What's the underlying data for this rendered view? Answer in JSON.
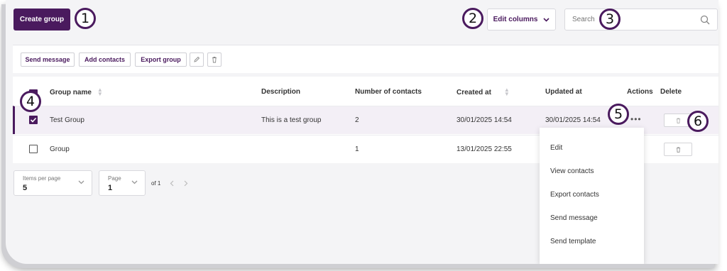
{
  "header": {
    "create_group_label": "Create group",
    "edit_columns_label": "Edit columns",
    "search_placeholder": "Search"
  },
  "toolbar": {
    "send_message_label": "Send message",
    "add_contacts_label": "Add contacts",
    "export_group_label": "Export group"
  },
  "table": {
    "columns": {
      "group_name": "Group name",
      "description": "Description",
      "number_of_contacts": "Number of contacts",
      "created_at": "Created at",
      "updated_at": "Updated at",
      "actions": "Actions",
      "delete": "Delete"
    },
    "rows": [
      {
        "name": "Test Group",
        "description": "This is a test group",
        "contacts": "2",
        "created_at": "30/01/2025 14:54",
        "updated_at": "30/01/2025 14:54",
        "selected": true
      },
      {
        "name": "Group",
        "description": "",
        "contacts": "1",
        "created_at": "13/01/2025 22:55",
        "updated_at": "",
        "selected": false
      }
    ]
  },
  "pagination": {
    "items_per_page_label": "Items per page",
    "items_per_page_value": "5",
    "page_label": "Page",
    "page_value": "1",
    "of_pages": "of 1"
  },
  "actions_menu": {
    "items": [
      "Edit",
      "View contacts",
      "Export contacts",
      "Send message",
      "Send template"
    ]
  },
  "callouts": [
    "1",
    "2",
    "3",
    "4",
    "5",
    "6"
  ],
  "colors": {
    "accent": "#4a1a5e",
    "selected_row": "#f3eff6"
  },
  "icons": [
    "search-icon",
    "chevron-down-icon",
    "pencil-icon",
    "trash-icon",
    "ellipsis-icon",
    "chevron-left-icon",
    "chevron-right-icon",
    "sort-icon",
    "checkbox-icon"
  ]
}
